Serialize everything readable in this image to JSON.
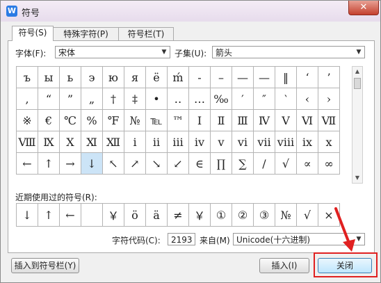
{
  "window": {
    "title": "符号",
    "app_icon": "W",
    "close_glyph": "✕"
  },
  "tabs": [
    {
      "label": "符号(S)"
    },
    {
      "label": "特殊字符(P)"
    },
    {
      "label": "符号栏(T)"
    }
  ],
  "font": {
    "label": "字体(F):",
    "value": "宋体"
  },
  "subset": {
    "label": "子集(U):",
    "value": "箭头"
  },
  "symbols": [
    [
      "ъ",
      "ы",
      "ь",
      "э",
      "ю",
      "я",
      "ё",
      "ḿ",
      "-",
      "–",
      "—",
      "—",
      "‖",
      "‘",
      "’"
    ],
    [
      ",",
      "“",
      "”",
      "„",
      "†",
      "‡",
      "•",
      "‥",
      "…",
      "‰",
      "′",
      "″",
      "‵",
      "‹",
      "›"
    ],
    [
      "※",
      "€",
      "℃",
      "%",
      "℉",
      "№",
      "℡",
      "™",
      "Ⅰ",
      "Ⅱ",
      "Ⅲ",
      "Ⅳ",
      "Ⅴ",
      "Ⅵ",
      "Ⅶ"
    ],
    [
      "Ⅷ",
      "Ⅸ",
      "Ⅹ",
      "Ⅺ",
      "Ⅻ",
      "ⅰ",
      "ⅱ",
      "ⅲ",
      "ⅳ",
      "ⅴ",
      "ⅵ",
      "ⅶ",
      "ⅷ",
      "ⅸ",
      "ⅹ"
    ],
    [
      "←",
      "↑",
      "→",
      "↓",
      "↖",
      "↗",
      "↘",
      "↙",
      "∈",
      "∏",
      "∑",
      "∕",
      "√",
      "∝",
      "∞"
    ]
  ],
  "recent": {
    "label": "近期使用过的符号(R):",
    "items": [
      "↓",
      "↑",
      "←",
      "",
      "￥",
      "ö",
      "ä",
      "≠",
      "￥",
      "①",
      "②",
      "③",
      "№",
      "√",
      "×"
    ]
  },
  "char_code": {
    "label": "字符代码(C):",
    "value": "2193"
  },
  "from": {
    "label": "来自(M)",
    "value": "Unicode(十六进制)"
  },
  "buttons": {
    "insert_to_bar": "插入到符号栏(Y)",
    "insert": "插入(I)",
    "close": "关闭"
  },
  "colors": {
    "selection": "#cce4f7",
    "annotation_red": "#e02020"
  }
}
